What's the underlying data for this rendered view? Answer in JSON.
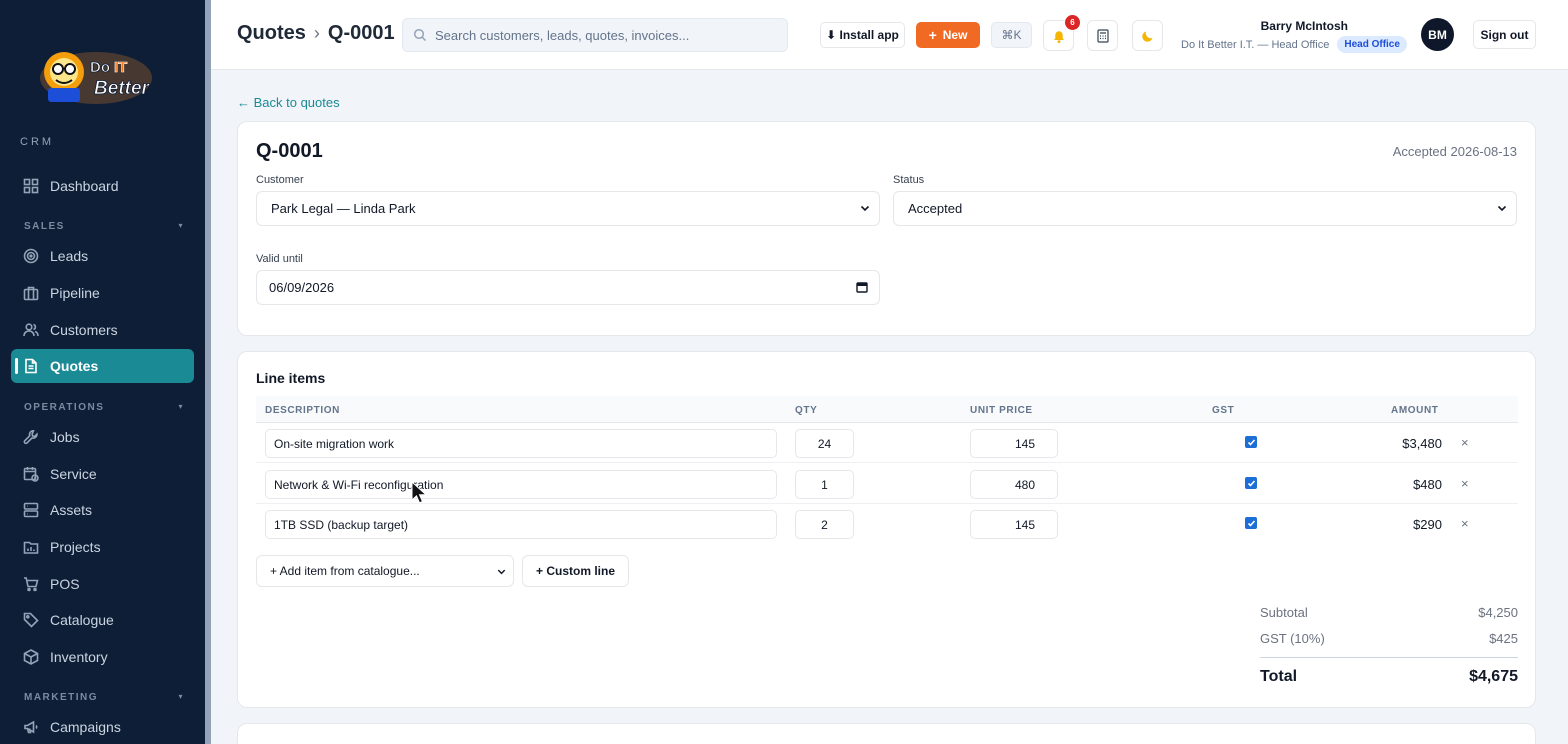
{
  "sidebar": {
    "brand_logo": "Do IT Better",
    "crm_label": "CRM",
    "dashboard": "Dashboard",
    "sections": {
      "sales": "SALES",
      "operations": "OPERATIONS",
      "marketing": "MARKETING"
    },
    "items": {
      "leads": "Leads",
      "pipeline": "Pipeline",
      "customers": "Customers",
      "quotes": "Quotes",
      "jobs": "Jobs",
      "service": "Service",
      "assets": "Assets",
      "projects": "Projects",
      "pos": "POS",
      "catalogue": "Catalogue",
      "inventory": "Inventory",
      "campaigns": "Campaigns"
    },
    "active": "quotes"
  },
  "header": {
    "breadcrumb_parent": "Quotes",
    "breadcrumb_sep": "›",
    "breadcrumb_current": "Q-0001",
    "search_placeholder": "Search customers, leads, quotes, invoices...",
    "install_label": "⬇ Install app",
    "new_label": "New",
    "shortcut_label": "⌘K",
    "notification_count": "6",
    "user_name": "Barry McIntosh",
    "user_org": "Do It Better I.T. — Head Office",
    "office_badge": "Head Office",
    "avatar_initials": "BM",
    "signout_label": "Sign out"
  },
  "main": {
    "back_link": "← Back to quotes",
    "quote_number": "Q-0001",
    "accepted_text": "Accepted 2026-08-13",
    "customer_label": "Customer",
    "customer_value": "Park Legal — Linda Park",
    "status_label": "Status",
    "status_value": "Accepted",
    "valid_until_label": "Valid until",
    "valid_until_value": "06/09/2026"
  },
  "line_items": {
    "title": "Line items",
    "columns": {
      "description": "DESCRIPTION",
      "qty": "QTY",
      "unit_price": "UNIT PRICE",
      "gst": "GST",
      "amount": "AMOUNT"
    },
    "rows": [
      {
        "description": "On-site migration work",
        "qty": "24",
        "unit_price": "145",
        "gst": true,
        "amount": "$3,480",
        "remove": "×"
      },
      {
        "description": "Network & Wi-Fi reconfiguration",
        "qty": "1",
        "unit_price": "480",
        "gst": true,
        "amount": "$480",
        "remove": "×"
      },
      {
        "description": "1TB SSD (backup target)",
        "qty": "2",
        "unit_price": "145",
        "gst": true,
        "amount": "$290",
        "remove": "×"
      }
    ],
    "add_from_catalogue": "+ Add item from catalogue...",
    "custom_line": "+ Custom line",
    "subtotal_label": "Subtotal",
    "subtotal_value": "$4,250",
    "gst_label": "GST (10%)",
    "gst_value": "$425",
    "total_label": "Total",
    "total_value": "$4,675"
  },
  "colors": {
    "sidebar_bg": "#0e1e36",
    "accent_teal": "#1a8a94",
    "new_button": "#f06a24",
    "checkbox_blue": "#1d6fd6",
    "notification_red": "#dc2626"
  }
}
